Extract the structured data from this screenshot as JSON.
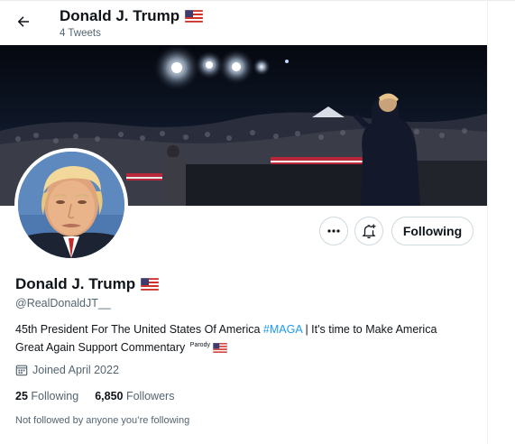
{
  "header": {
    "title": "Donald J. Trump",
    "tweet_count": "4 Tweets",
    "back_icon": "arrow-left-icon",
    "flag_icon": "us-flag-icon"
  },
  "profile": {
    "display_name": "Donald J. Trump",
    "handle": "@RealDonaldJT__",
    "bio_before_tag": "45th President For The United States Of America ",
    "bio_hashtag": "#MAGA",
    "bio_after_tag": " | It's time to Make America Great Again Support Commentary",
    "bio_parody": "Parody",
    "joined": "Joined April 2022",
    "following_count": "25",
    "following_label": "Following",
    "followers_count": "6,850",
    "followers_label": "Followers",
    "not_followed_text": "Not followed by anyone you’re following"
  },
  "actions": {
    "more_icon": "more-dots-icon",
    "notify_icon": "bell-plus-icon",
    "following_button": "Following"
  },
  "colors": {
    "accent": "#1d9bf0",
    "text_primary": "#0f1419",
    "text_secondary": "#536471",
    "border": "#cfd9de"
  }
}
